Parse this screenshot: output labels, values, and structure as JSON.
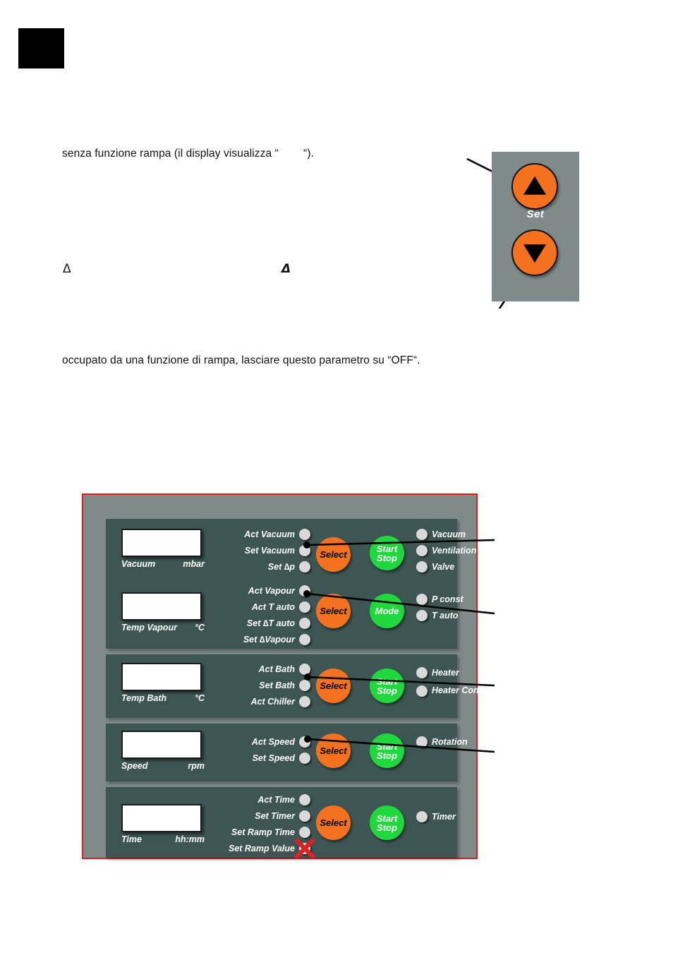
{
  "page": {
    "redaction_block": "",
    "body_text": {
      "line1": "senza funzione rampa (il display visualizza “        “).",
      "line2": "occupato da una funzione di rampa, lasciare questo parametro su “OFF“.",
      "delta_upright": "Δ",
      "delta_italic": "Δ"
    }
  },
  "set_figure": {
    "up_button": "▲",
    "down_button": "▼",
    "label": "Set"
  },
  "control_panel": {
    "border_color": "#e02020",
    "background_color": "#7f8a8a",
    "group_color": "#3d5653",
    "select_button_color": "#f4711f",
    "green_button_color": "#1fd83c",
    "led_color": "#d9d9d9",
    "mark_color": "#e02020",
    "groups": [
      {
        "id": "vacuum",
        "display": {
          "name": "Vacuum",
          "unit": "mbar",
          "value": ""
        },
        "leds": [
          "Act Vacuum",
          "Set Vacuum",
          "Set ∆p"
        ],
        "select_label": "Select",
        "action_label_line1": "Start",
        "action_label_line2": "Stop",
        "status_leds": [
          "Vacuum",
          "Ventilation",
          "Valve"
        ]
      },
      {
        "id": "temp-vapour",
        "display": {
          "name": "Temp Vapour",
          "unit": "°C",
          "value": ""
        },
        "leds": [
          "Act Vapour",
          "Act T auto",
          "Set ∆T auto",
          "Set ∆Vapour"
        ],
        "select_label": "Select",
        "action_label_line1": "Mode",
        "action_label_line2": "",
        "status_leds": [
          "P const",
          "T auto"
        ]
      },
      {
        "id": "temp-bath",
        "display": {
          "name": "Temp Bath",
          "unit": "°C",
          "value": ""
        },
        "leds": [
          "Act Bath",
          "Set Bath",
          "Act Chiller"
        ],
        "select_label": "Select",
        "action_label_line1": "Start",
        "action_label_line2": "Stop",
        "status_leds": [
          "Heater",
          "Heater Control"
        ]
      },
      {
        "id": "speed",
        "display": {
          "name": "Speed",
          "unit": "rpm",
          "value": ""
        },
        "leds": [
          "Act Speed",
          "Set Speed"
        ],
        "select_label": "Select",
        "action_label_line1": "Start",
        "action_label_line2": "Stop",
        "status_leds": [
          "Rotation"
        ]
      },
      {
        "id": "time",
        "display": {
          "name": "Time",
          "unit": "hh:mm",
          "value": ""
        },
        "leds": [
          "Act Time",
          "Set Timer",
          "Set Ramp Time",
          "Set Ramp Value"
        ],
        "select_label": "Select",
        "action_label_line1": "Start",
        "action_label_line2": "Stop",
        "status_leds": [
          "Timer"
        ],
        "crossed_out_led": "Set Ramp Value"
      }
    ]
  }
}
